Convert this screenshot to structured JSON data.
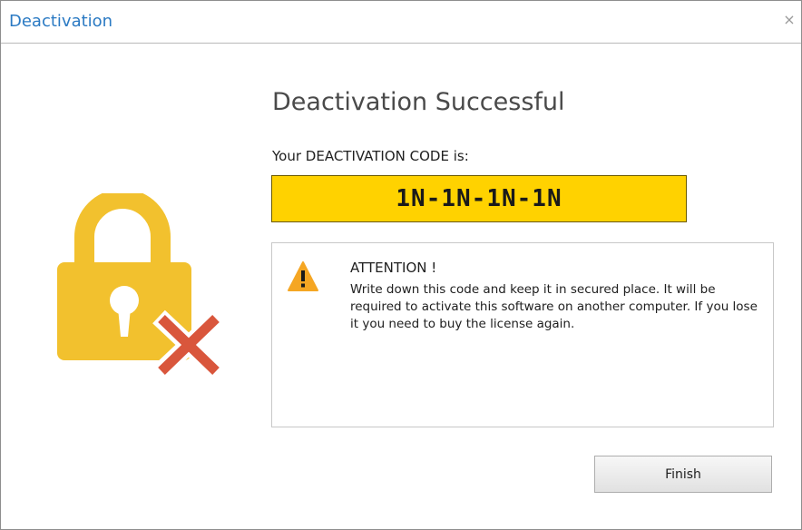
{
  "window": {
    "title": "Deactivation",
    "close_glyph": "×"
  },
  "main": {
    "heading": "Deactivation Successful",
    "code_caption": "Your DEACTIVATION CODE is:",
    "code": "1N-1N-1N-1N",
    "code_bg_color": "#ffd200"
  },
  "attention": {
    "title": "ATTENTION !",
    "body": "Write down this code and keep it in secured place. It will be required to activate this software on another computer. If you lose it you need to buy the license again.",
    "icon": "warning-icon",
    "icon_color": "#f5a623"
  },
  "lock": {
    "icon": "lock-icon",
    "lock_color": "#f2c12e",
    "x_color": "#d9563c"
  },
  "buttons": {
    "finish_label": "Finish"
  }
}
